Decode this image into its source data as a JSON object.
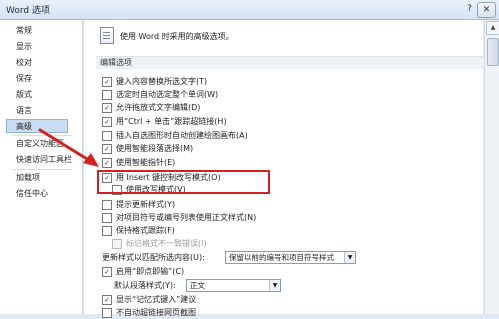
{
  "window": {
    "title": "Word 选项",
    "help": "?",
    "close": "✕"
  },
  "sidebar": {
    "items": [
      "常规",
      "显示",
      "校对",
      "保存",
      "版式",
      "语言",
      "高级",
      "自定义功能区",
      "快速访问工具栏",
      "加载项",
      "信任中心"
    ],
    "selected": "高级"
  },
  "header": {
    "text": "使用 Word 时采用的高级选项。"
  },
  "section": {
    "title": "编辑选项"
  },
  "options": [
    {
      "label": "键入内容替换所选文字(T)",
      "checked": true,
      "enabled": true
    },
    {
      "label": "选定时自动选定整个单词(W)",
      "checked": false,
      "enabled": true
    },
    {
      "label": "允许拖放式文字编辑(D)",
      "checked": true,
      "enabled": true
    },
    {
      "label": "用“Ctrl + 单击”跟踪超链接(H)",
      "checked": true,
      "enabled": true
    },
    {
      "label": "插入自选图形时自动创建绘图画布(A)",
      "checked": false,
      "enabled": true
    },
    {
      "label": "使用智能段落选择(M)",
      "checked": true,
      "enabled": true
    },
    {
      "label": "使用智能指针(E)",
      "checked": true,
      "enabled": true
    },
    {
      "label": "用 Insert 键控制改写模式(O)",
      "checked": true,
      "enabled": true
    },
    {
      "label": "使用改写模式(V)",
      "checked": false,
      "enabled": true
    },
    {
      "label": "提示更新样式(Y)",
      "checked": false,
      "enabled": true
    },
    {
      "label": "对项目符号或编号列表使用正文样式(N)",
      "checked": false,
      "enabled": true
    },
    {
      "label": "保持格式跟踪(F)",
      "checked": false,
      "enabled": true
    },
    {
      "label": "标记格式不一致错误(I)",
      "checked": false,
      "enabled": false
    }
  ],
  "style_update": {
    "label": "更新样式以匹配所选内容(U):",
    "value": "保留以前的编号和项目符号样式",
    "arrow": "▼"
  },
  "click_and_type": {
    "label": "启用“即点即输”(C)",
    "checked": true
  },
  "default_para_style": {
    "label": "默认段落样式(Y):",
    "value": "正文",
    "arrow": "▼"
  },
  "autocomplete": {
    "label": "显示“记忆式键入”建议",
    "checked": true
  },
  "cut_off": {
    "label": "不自动超链接网页截图"
  },
  "check_mark": "✓",
  "scroll_up": "▲",
  "colors": {
    "highlight": "#d42020",
    "selected_nav": "#c8dcf3"
  }
}
